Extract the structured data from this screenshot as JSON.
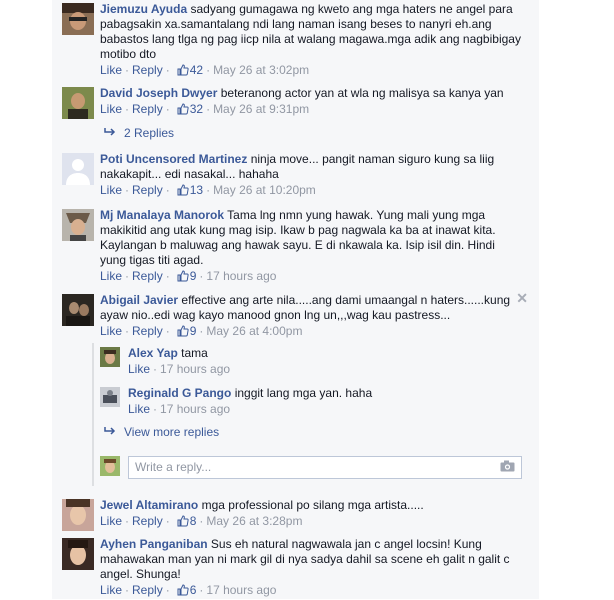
{
  "actions": {
    "like": "Like",
    "reply": "Reply",
    "dot": "·"
  },
  "comments": [
    {
      "name": "Jiemuzu Ayuda",
      "text": "sadyang gumagawa ng kweto ang mga haters ne angel para pabagsakin xa.samantalang ndi lang naman isang beses to nanyri eh.ang babastos lang tlga ng pag iicp nila at walang magawa.mga adik ang nagbibigay motibo dto",
      "likes": "42",
      "time": "May 26 at 3:02pm"
    },
    {
      "name": "David Joseph Dwyer",
      "text": "beteranong actor yan at wla ng malisya sa kanya yan",
      "likes": "32",
      "time": "May 26 at 9:31pm",
      "replies_link": "2 Replies"
    },
    {
      "name": "Poti Uncensored Martinez",
      "text": "ninja move... pangit naman siguro kung sa liig nakakapit... edi nasakal... hahaha",
      "likes": "13",
      "time": "May 26 at 10:20pm"
    },
    {
      "name": "Mj Manalaya Manorok",
      "text": "Tama lng nmn yung hawak. Yung mali yung mga makikitid ang utak kung mag isip. Ikaw b pag nagwala ka ba at inawat kita. Kaylangan b maluwag ang hawak sayu. E di nkawala ka. Isip isil din. Hindi yung tigas titi agad.",
      "likes": "9",
      "time": "17 hours ago"
    },
    {
      "name": "Abigail Javier",
      "text": "effective ang arte nila.....ang dami umaangal n haters......kung ayaw nio..edi wag kayo manood gnon lng un,,,wag kau pastress...",
      "likes": "9",
      "time": "May 26 at 4:00pm",
      "replies": [
        {
          "name": "Alex Yap",
          "text": "tama",
          "time": "17 hours ago"
        },
        {
          "name": "Reginald G Pango",
          "text": "inggit lang mga yan. haha",
          "time": "17 hours ago"
        }
      ],
      "view_more": "View more replies",
      "write_placeholder": "Write a reply..."
    },
    {
      "name": "Jewel Altamirano",
      "text": "mga professional po silang mga artista.....",
      "likes": "8",
      "time": "May 26 at 3:28pm"
    },
    {
      "name": "Ayhen Panganiban",
      "text": "Sus eh natural nagwawala jan c angel locsin! Kung mahawakan man yan ni mark gil di nya sadya dahil sa scene eh galit n galit c angel. Shunga!",
      "likes": "6",
      "time": "17 hours ago"
    }
  ],
  "icons": {
    "like": "thumbs-up-icon",
    "camera": "camera-icon",
    "close": "close-icon",
    "reply_arrow": "reply-arrow-icon"
  },
  "colors": {
    "link": "#3b5998",
    "meta": "#9197a3",
    "panel": "#f6f7f9"
  }
}
